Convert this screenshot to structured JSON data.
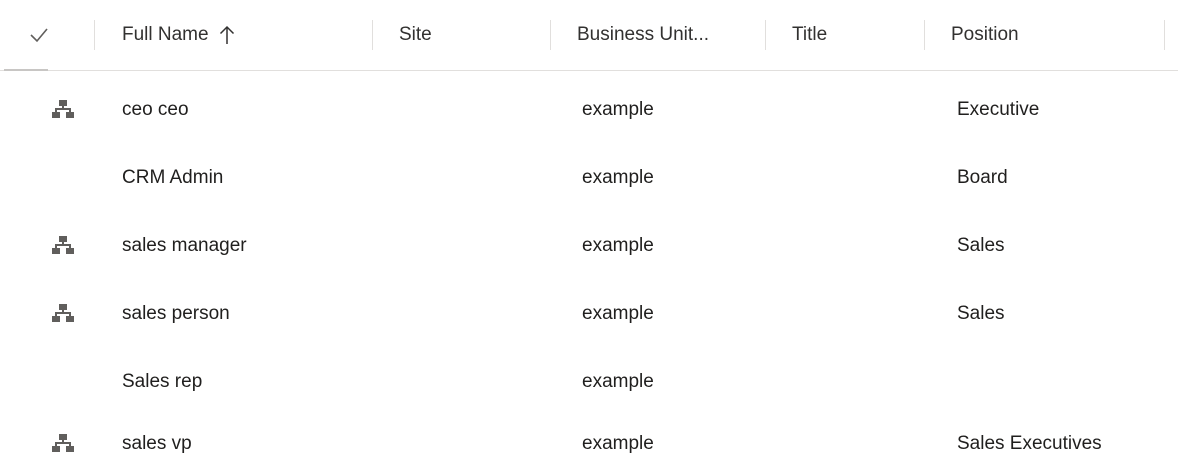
{
  "columns": {
    "full_name": "Full Name",
    "site": "Site",
    "business_unit": "Business Unit...",
    "title": "Title",
    "position": "Position"
  },
  "header": {
    "select_all_icon": "checkmark-icon",
    "sort_icon": "sort-ascending-arrow-icon"
  },
  "rows": [
    {
      "hierarchy_icon": true,
      "full_name": "ceo ceo",
      "site": "",
      "business_unit": "example",
      "title": "",
      "position": "Executive"
    },
    {
      "hierarchy_icon": false,
      "full_name": "CRM Admin",
      "site": "",
      "business_unit": "example",
      "title": "",
      "position": "Board"
    },
    {
      "hierarchy_icon": true,
      "full_name": "sales manager",
      "site": "",
      "business_unit": "example",
      "title": "",
      "position": "Sales"
    },
    {
      "hierarchy_icon": true,
      "full_name": "sales person",
      "site": "",
      "business_unit": "example",
      "title": "",
      "position": "Sales"
    },
    {
      "hierarchy_icon": false,
      "full_name": "Sales rep",
      "site": "",
      "business_unit": "example",
      "title": "",
      "position": ""
    },
    {
      "hierarchy_icon": true,
      "full_name": "sales vp",
      "site": "",
      "business_unit": "example",
      "title": "",
      "position": "Sales Executives"
    }
  ],
  "colors": {
    "icon": "#605e5c",
    "separator": "#e1dfdd",
    "text": "#201f1e"
  }
}
